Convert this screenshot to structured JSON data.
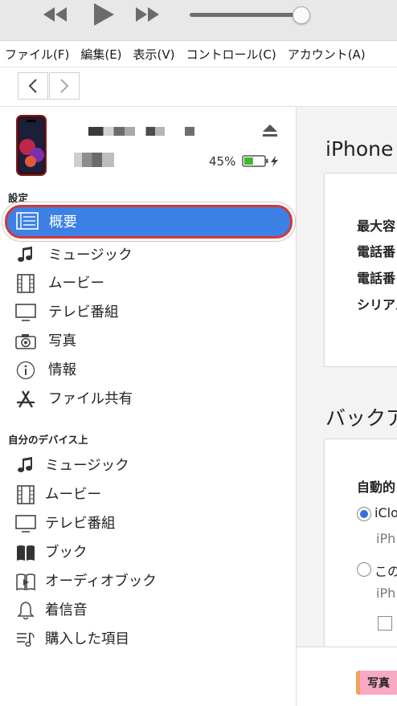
{
  "transport": {
    "rewind_icon": "rewind-icon",
    "play_icon": "play-icon",
    "forward_icon": "fast-forward-icon",
    "volume_level": 0.92
  },
  "menu": [
    "ファイル(F)",
    "編集(E)",
    "表示(V)",
    "コントロール(C)",
    "アカウント(A)"
  ],
  "device": {
    "battery_percent": "45%",
    "battery_level": 0.45,
    "charging": true
  },
  "sidebar": {
    "settings_header": "設定",
    "settings_items": [
      {
        "label": "概要",
        "icon": "summary-list-icon",
        "selected": true
      },
      {
        "label": "ミュージック",
        "icon": "music-note-icon"
      },
      {
        "label": "ムービー",
        "icon": "film-icon"
      },
      {
        "label": "テレビ番組",
        "icon": "tv-icon"
      },
      {
        "label": "写真",
        "icon": "camera-icon"
      },
      {
        "label": "情報",
        "icon": "info-icon"
      },
      {
        "label": "ファイル共有",
        "icon": "app-store-icon"
      }
    ],
    "ondevice_header": "自分のデバイス上",
    "ondevice_items": [
      {
        "label": "ミュージック",
        "icon": "music-note-icon"
      },
      {
        "label": "ムービー",
        "icon": "film-icon"
      },
      {
        "label": "テレビ番組",
        "icon": "tv-icon"
      },
      {
        "label": "ブック",
        "icon": "book-icon"
      },
      {
        "label": "オーディオブック",
        "icon": "audiobook-icon"
      },
      {
        "label": "着信音",
        "icon": "bell-icon"
      },
      {
        "label": "購入した項目",
        "icon": "purchased-list-icon"
      }
    ]
  },
  "main": {
    "device_title": "iPhone",
    "info_rows": [
      "最大容",
      "電話番",
      "電話番",
      "シリアル"
    ],
    "backup_title": "バックア",
    "auto_backup": "自動的",
    "option_icloud": "iClo",
    "option_icloud_sub": "iPh",
    "option_this_pc": "この",
    "option_this_pc_sub": "iPh",
    "storage_photos": "写真"
  }
}
